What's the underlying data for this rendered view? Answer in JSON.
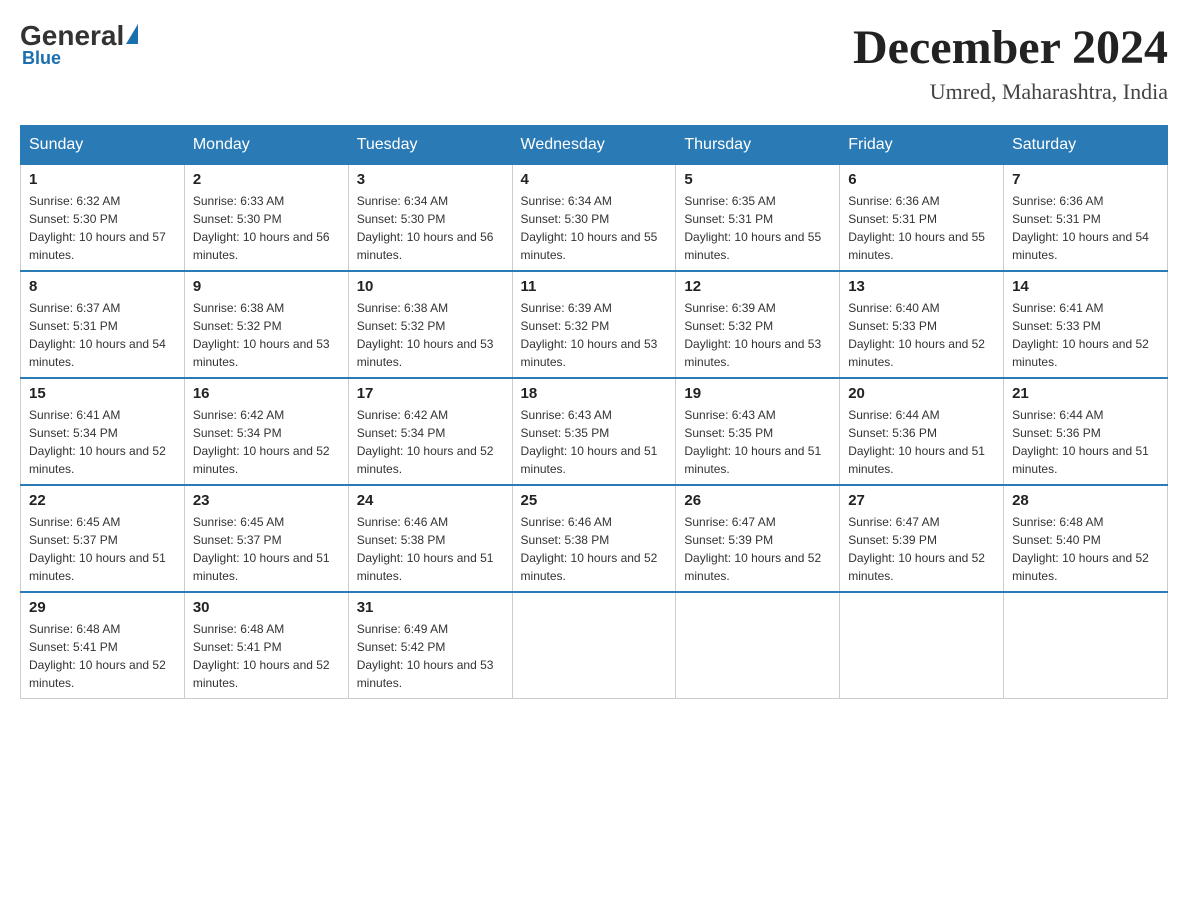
{
  "header": {
    "logo": {
      "general": "General",
      "blue": "Blue",
      "triangle": "▶"
    },
    "title": "December 2024",
    "subtitle": "Umred, Maharashtra, India"
  },
  "columns": [
    "Sunday",
    "Monday",
    "Tuesday",
    "Wednesday",
    "Thursday",
    "Friday",
    "Saturday"
  ],
  "weeks": [
    [
      {
        "day": "1",
        "sunrise": "6:32 AM",
        "sunset": "5:30 PM",
        "daylight": "10 hours and 57 minutes."
      },
      {
        "day": "2",
        "sunrise": "6:33 AM",
        "sunset": "5:30 PM",
        "daylight": "10 hours and 56 minutes."
      },
      {
        "day": "3",
        "sunrise": "6:34 AM",
        "sunset": "5:30 PM",
        "daylight": "10 hours and 56 minutes."
      },
      {
        "day": "4",
        "sunrise": "6:34 AM",
        "sunset": "5:30 PM",
        "daylight": "10 hours and 55 minutes."
      },
      {
        "day": "5",
        "sunrise": "6:35 AM",
        "sunset": "5:31 PM",
        "daylight": "10 hours and 55 minutes."
      },
      {
        "day": "6",
        "sunrise": "6:36 AM",
        "sunset": "5:31 PM",
        "daylight": "10 hours and 55 minutes."
      },
      {
        "day": "7",
        "sunrise": "6:36 AM",
        "sunset": "5:31 PM",
        "daylight": "10 hours and 54 minutes."
      }
    ],
    [
      {
        "day": "8",
        "sunrise": "6:37 AM",
        "sunset": "5:31 PM",
        "daylight": "10 hours and 54 minutes."
      },
      {
        "day": "9",
        "sunrise": "6:38 AM",
        "sunset": "5:32 PM",
        "daylight": "10 hours and 53 minutes."
      },
      {
        "day": "10",
        "sunrise": "6:38 AM",
        "sunset": "5:32 PM",
        "daylight": "10 hours and 53 minutes."
      },
      {
        "day": "11",
        "sunrise": "6:39 AM",
        "sunset": "5:32 PM",
        "daylight": "10 hours and 53 minutes."
      },
      {
        "day": "12",
        "sunrise": "6:39 AM",
        "sunset": "5:32 PM",
        "daylight": "10 hours and 53 minutes."
      },
      {
        "day": "13",
        "sunrise": "6:40 AM",
        "sunset": "5:33 PM",
        "daylight": "10 hours and 52 minutes."
      },
      {
        "day": "14",
        "sunrise": "6:41 AM",
        "sunset": "5:33 PM",
        "daylight": "10 hours and 52 minutes."
      }
    ],
    [
      {
        "day": "15",
        "sunrise": "6:41 AM",
        "sunset": "5:34 PM",
        "daylight": "10 hours and 52 minutes."
      },
      {
        "day": "16",
        "sunrise": "6:42 AM",
        "sunset": "5:34 PM",
        "daylight": "10 hours and 52 minutes."
      },
      {
        "day": "17",
        "sunrise": "6:42 AM",
        "sunset": "5:34 PM",
        "daylight": "10 hours and 52 minutes."
      },
      {
        "day": "18",
        "sunrise": "6:43 AM",
        "sunset": "5:35 PM",
        "daylight": "10 hours and 51 minutes."
      },
      {
        "day": "19",
        "sunrise": "6:43 AM",
        "sunset": "5:35 PM",
        "daylight": "10 hours and 51 minutes."
      },
      {
        "day": "20",
        "sunrise": "6:44 AM",
        "sunset": "5:36 PM",
        "daylight": "10 hours and 51 minutes."
      },
      {
        "day": "21",
        "sunrise": "6:44 AM",
        "sunset": "5:36 PM",
        "daylight": "10 hours and 51 minutes."
      }
    ],
    [
      {
        "day": "22",
        "sunrise": "6:45 AM",
        "sunset": "5:37 PM",
        "daylight": "10 hours and 51 minutes."
      },
      {
        "day": "23",
        "sunrise": "6:45 AM",
        "sunset": "5:37 PM",
        "daylight": "10 hours and 51 minutes."
      },
      {
        "day": "24",
        "sunrise": "6:46 AM",
        "sunset": "5:38 PM",
        "daylight": "10 hours and 51 minutes."
      },
      {
        "day": "25",
        "sunrise": "6:46 AM",
        "sunset": "5:38 PM",
        "daylight": "10 hours and 52 minutes."
      },
      {
        "day": "26",
        "sunrise": "6:47 AM",
        "sunset": "5:39 PM",
        "daylight": "10 hours and 52 minutes."
      },
      {
        "day": "27",
        "sunrise": "6:47 AM",
        "sunset": "5:39 PM",
        "daylight": "10 hours and 52 minutes."
      },
      {
        "day": "28",
        "sunrise": "6:48 AM",
        "sunset": "5:40 PM",
        "daylight": "10 hours and 52 minutes."
      }
    ],
    [
      {
        "day": "29",
        "sunrise": "6:48 AM",
        "sunset": "5:41 PM",
        "daylight": "10 hours and 52 minutes."
      },
      {
        "day": "30",
        "sunrise": "6:48 AM",
        "sunset": "5:41 PM",
        "daylight": "10 hours and 52 minutes."
      },
      {
        "day": "31",
        "sunrise": "6:49 AM",
        "sunset": "5:42 PM",
        "daylight": "10 hours and 53 minutes."
      },
      null,
      null,
      null,
      null
    ]
  ]
}
